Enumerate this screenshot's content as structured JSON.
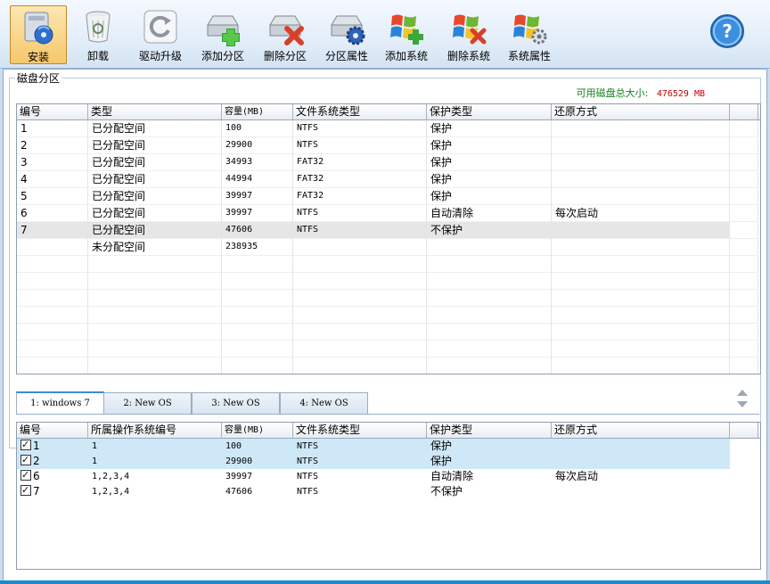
{
  "toolbar": {
    "buttons": [
      {
        "label": "安装",
        "icon": "install-disk-icon",
        "active": true
      },
      {
        "label": "卸载",
        "icon": "trash-icon"
      },
      {
        "label": "驱动升级",
        "icon": "refresh-icon"
      },
      {
        "label": "添加分区",
        "icon": "add-partition-icon"
      },
      {
        "label": "删除分区",
        "icon": "delete-partition-icon"
      },
      {
        "label": "分区属性",
        "icon": "partition-settings-icon"
      },
      {
        "label": "添加系统",
        "icon": "add-os-icon"
      },
      {
        "label": "删除系统",
        "icon": "delete-os-icon"
      },
      {
        "label": "系统属性",
        "icon": "os-settings-icon"
      }
    ],
    "help_label": "?"
  },
  "disk": {
    "group_title": "磁盘分区",
    "available_label": "可用磁盘总大小:",
    "available_value": "476529 MB"
  },
  "partitions": {
    "headers": [
      "编号",
      "类型",
      "容量(MB)",
      "文件系统类型",
      "保护类型",
      "还原方式"
    ],
    "rows": [
      [
        "1",
        "已分配空间",
        "100",
        "NTFS",
        "保护",
        ""
      ],
      [
        "2",
        "已分配空间",
        "29900",
        "NTFS",
        "保护",
        ""
      ],
      [
        "3",
        "已分配空间",
        "34993",
        "FAT32",
        "保护",
        ""
      ],
      [
        "4",
        "已分配空间",
        "44994",
        "FAT32",
        "保护",
        ""
      ],
      [
        "5",
        "已分配空间",
        "39997",
        "FAT32",
        "保护",
        ""
      ],
      [
        "6",
        "已分配空间",
        "39997",
        "NTFS",
        "自动清除",
        "每次启动"
      ],
      [
        "7",
        "已分配空间",
        "47606",
        "NTFS",
        "不保护",
        ""
      ],
      [
        "",
        "未分配空间",
        "238935",
        "",
        "",
        ""
      ]
    ]
  },
  "tabs": [
    "1: windows 7",
    "2: New OS",
    "3: New OS",
    "4: New OS"
  ],
  "os_partitions": {
    "headers": [
      "编号",
      "所属操作系统编号",
      "容量(MB)",
      "文件系统类型",
      "保护类型",
      "还原方式"
    ],
    "rows": [
      [
        "1",
        "1",
        "100",
        "NTFS",
        "保护",
        ""
      ],
      [
        "2",
        "1",
        "29900",
        "NTFS",
        "保护",
        ""
      ],
      [
        "6",
        "1,2,3,4",
        "39997",
        "NTFS",
        "自动清除",
        "每次启动"
      ],
      [
        "7",
        "1,2,3,4",
        "47606",
        "NTFS",
        "不保护",
        ""
      ]
    ]
  }
}
